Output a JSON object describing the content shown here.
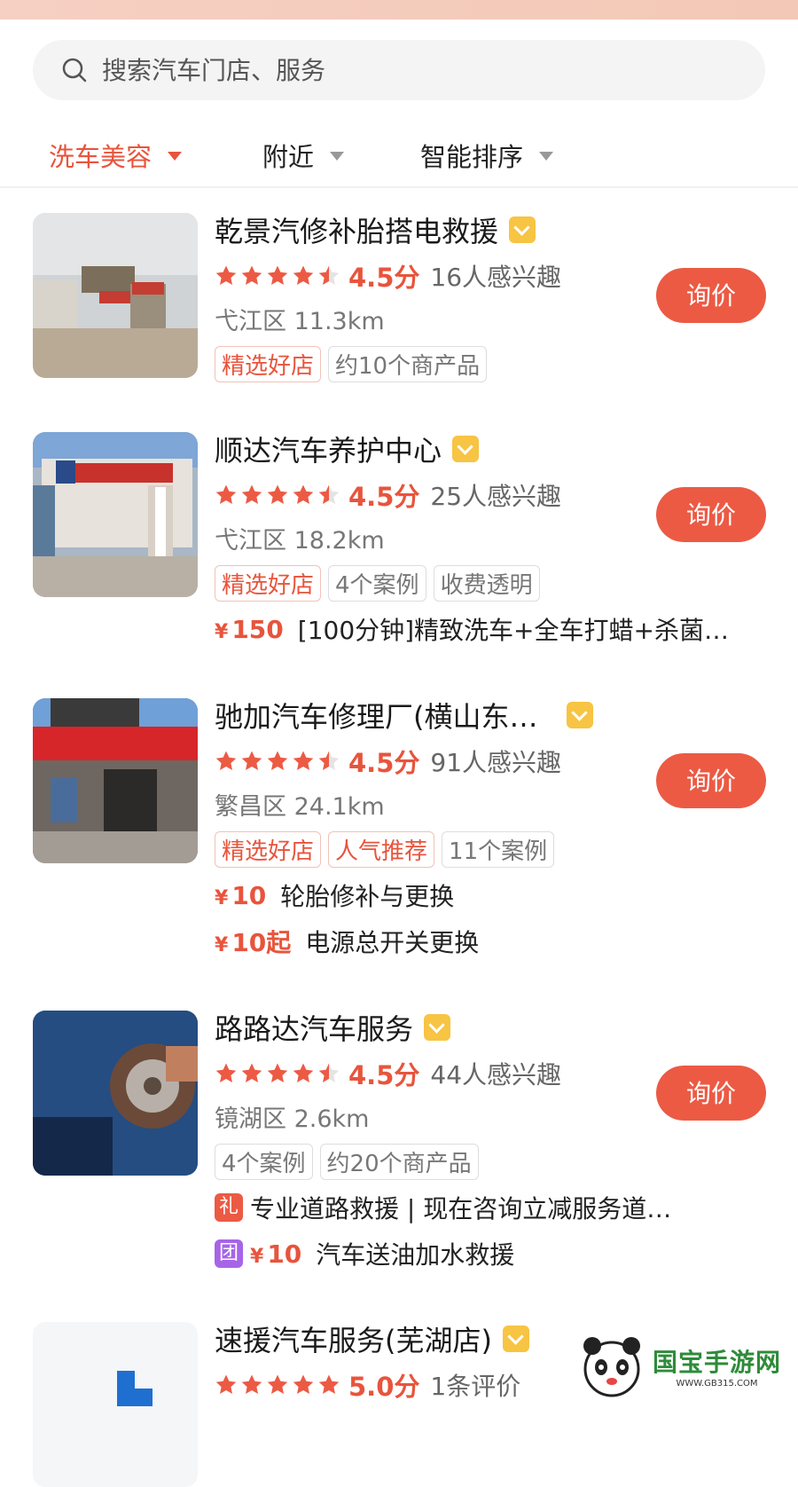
{
  "search": {
    "placeholder": "搜索汽车门店、服务"
  },
  "filters": [
    {
      "label": "洗车美容",
      "active": true
    },
    {
      "label": "附近",
      "active": false
    },
    {
      "label": "智能排序",
      "active": false
    }
  ],
  "shops": [
    {
      "name": "乾景汽修补胎搭电救援",
      "score": "4.5分",
      "rating": 4.5,
      "interest": "16人感兴趣",
      "location": "弋江区 11.3km",
      "tags": [
        "精选好店",
        "约10个商产品"
      ],
      "ask_label": "询价"
    },
    {
      "name": "顺达汽车养护中心",
      "score": "4.5分",
      "rating": 4.5,
      "interest": "25人感兴趣",
      "location": "弋江区 18.2km",
      "tags": [
        "精选好店",
        "4个案例",
        "收费透明"
      ],
      "ask_label": "询价",
      "offers": [
        {
          "price": "150",
          "desc": "[100分钟]精致洗车+全车打蜡+杀菌…"
        }
      ]
    },
    {
      "name": "驰加汽车修理厂(横山东…",
      "score": "4.5分",
      "rating": 4.5,
      "interest": "91人感兴趣",
      "location": "繁昌区 24.1km",
      "tags": [
        "精选好店",
        "人气推荐",
        "11个案例"
      ],
      "ask_label": "询价",
      "offers": [
        {
          "price": "10",
          "desc": "轮胎修补与更换"
        },
        {
          "price": "10起",
          "desc": "电源总开关更换"
        }
      ]
    },
    {
      "name": "路路达汽车服务",
      "score": "4.5分",
      "rating": 4.5,
      "interest": "44人感兴趣",
      "location": "镜湖区 2.6km",
      "tags": [
        "4个案例",
        "约20个商产品"
      ],
      "ask_label": "询价",
      "gift": {
        "icon_text": "礼",
        "desc": "专业道路救援 | 现在咨询立减服务道…"
      },
      "group": {
        "icon_text": "团",
        "price": "10",
        "desc": "汽车送油加水救援"
      }
    },
    {
      "name": "速援汽车服务(芜湖店)",
      "score": "5.0分",
      "rating": 5.0,
      "interest": "1条评价"
    }
  ],
  "currency": "¥",
  "watermark": {
    "brand": "国宝手游网",
    "url": "WWW.GB315.COM"
  },
  "colors": {
    "accent": "#e8543c",
    "button": "#ec5a44",
    "badge": "#f7c443",
    "star": "#ec5a44"
  }
}
